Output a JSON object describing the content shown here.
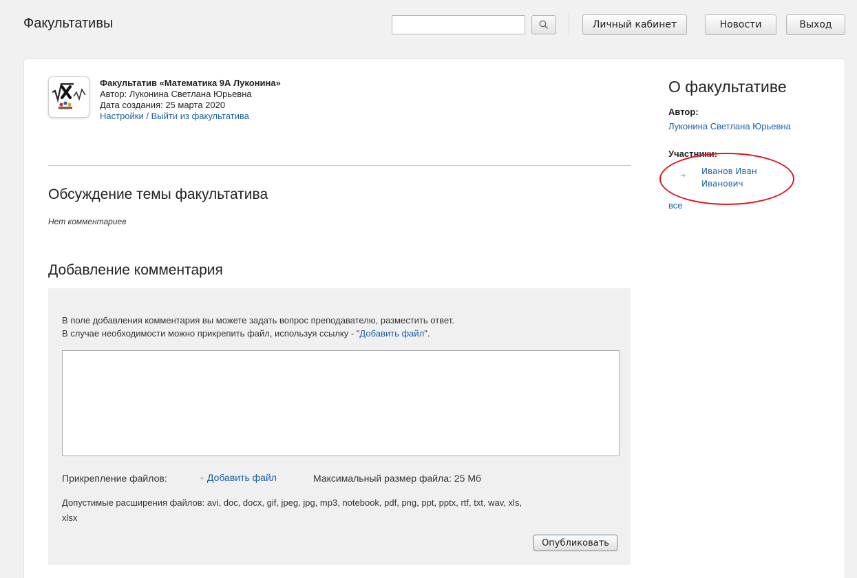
{
  "header": {
    "title": "Факультативы",
    "search_value": "",
    "nav": {
      "cabinet": "Личный кабинет",
      "news": "Новости",
      "logout": "Выход"
    }
  },
  "course": {
    "logo_icon": "math-sqrt-x-logo",
    "title": "Факультатив «Математика 9А Луконина»",
    "author_line": "Автор: Луконина Светлана Юрьевна",
    "created_line": "Дата создания: 25 марта 2020",
    "settings_link": "Настройки",
    "separator": "/",
    "leave_link": "Выйти из факультатива"
  },
  "discussion": {
    "heading": "Обсуждение темы факультатива",
    "empty_text": "Нет комментариев"
  },
  "add_comment": {
    "heading": "Добавление комментария",
    "hint_line1": "В поле добавления комментария вы можете задать вопрос преподавателю, разместить ответ.",
    "hint_line2_prefix": "В случае необходимости можно прикрепить файл, используя ссылку - \"",
    "hint_line2_link": "Добавить файл",
    "hint_line2_suffix": "\".",
    "textarea_value": "",
    "attach_label": "Прикрепление файлов:",
    "attach_link": "Добавить файл",
    "max_size": "Максимальный размер файла: 25 Мб",
    "extensions_line1": "Допустимые расширения файлов: avi, doc, docx, gif, jpeg, jpg, mp3, notebook, pdf, png, ppt, pptx, rtf, txt, wav, xls,",
    "extensions_line2": "xlsx",
    "publish_label": "Опубликовать"
  },
  "sidebar": {
    "title": "О факультативе",
    "author_label": "Автор:",
    "author_name": "Луконина Светлана Юрьевна",
    "members_label": "Участники:",
    "members": [
      {
        "name": "Иванов Иван Иванович"
      }
    ],
    "all_link": "все"
  },
  "colors": {
    "link": "#1a5fa8",
    "highlight": "#e0151d",
    "page_bg": "#f1f1f1",
    "comment_bg": "#f0f0f0"
  }
}
